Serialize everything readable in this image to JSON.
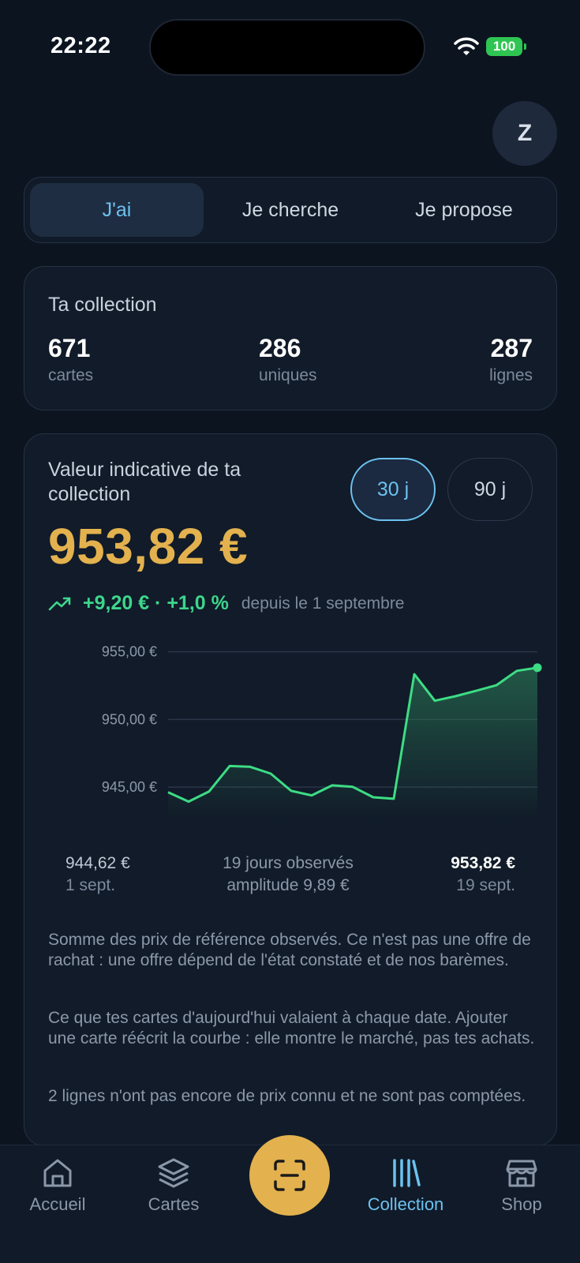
{
  "status": {
    "time": "22:22",
    "battery": "100"
  },
  "avatar": {
    "initial": "Z"
  },
  "tabs": [
    {
      "label": "J'ai",
      "active": true
    },
    {
      "label": "Je cherche",
      "active": false
    },
    {
      "label": "Je propose",
      "active": false
    }
  ],
  "collection": {
    "title": "Ta collection",
    "stats": [
      {
        "value": "671",
        "label": "cartes"
      },
      {
        "value": "286",
        "label": "uniques"
      },
      {
        "value": "287",
        "label": "lignes"
      }
    ]
  },
  "valuation": {
    "title": "Valeur indicative de ta collection",
    "periods": [
      "30 j",
      "90 j"
    ],
    "selected_period": "30 j",
    "total": "953,82 €",
    "delta": "+9,20 € · +1,0 %",
    "since": "depuis le 1 septembre",
    "start_value": "944,62 €",
    "start_date": "1 sept.",
    "days_observed": "19 jours observés",
    "amplitude": "amplitude 9,89 €",
    "end_value": "953,82 €",
    "end_date": "19 sept.",
    "notes": [
      "Somme des prix de référence observés. Ce n'est pas une offre de rachat : une offre dépend de l'état constaté et de nos barèmes.",
      "Ce que tes cartes d'aujourd'hui valaient à chaque date. Ajouter une carte réécrit la courbe : elle montre le marché, pas tes achats.",
      "2 lignes n'ont pas encore de prix connu et ne sont pas comptées."
    ]
  },
  "chart_data": {
    "type": "area",
    "x": [
      1,
      2,
      3,
      4,
      5,
      6,
      7,
      8,
      9,
      10,
      11,
      12,
      13,
      14,
      15,
      16,
      17,
      18,
      19
    ],
    "series": [
      {
        "values": [
          944.62,
          943.93,
          944.68,
          946.56,
          946.5,
          946.0,
          944.72,
          944.39,
          945.13,
          945.02,
          944.25,
          944.14,
          953.34,
          951.38,
          951.71,
          952.11,
          952.52,
          953.59,
          953.82
        ]
      }
    ],
    "y_ticks": [
      "955,00 €",
      "950,00 €",
      "945,00 €"
    ],
    "y_tick_values": [
      955,
      950,
      945
    ],
    "ylim": [
      942.5,
      956.2
    ],
    "line_color": "#3ddc84",
    "grid": true
  },
  "nav": {
    "items": [
      {
        "label": "Accueil",
        "icon": "home-icon"
      },
      {
        "label": "Cartes",
        "icon": "layers-icon"
      },
      {
        "label": "Collection",
        "icon": "library-icon",
        "active": true
      },
      {
        "label": "Shop",
        "icon": "shop-icon"
      }
    ],
    "scan_icon": "scan-icon"
  },
  "colors": {
    "accent": "#6cc2ef",
    "gold": "#e3b14e",
    "positive": "#3dd68c",
    "background": "#0c1420"
  }
}
